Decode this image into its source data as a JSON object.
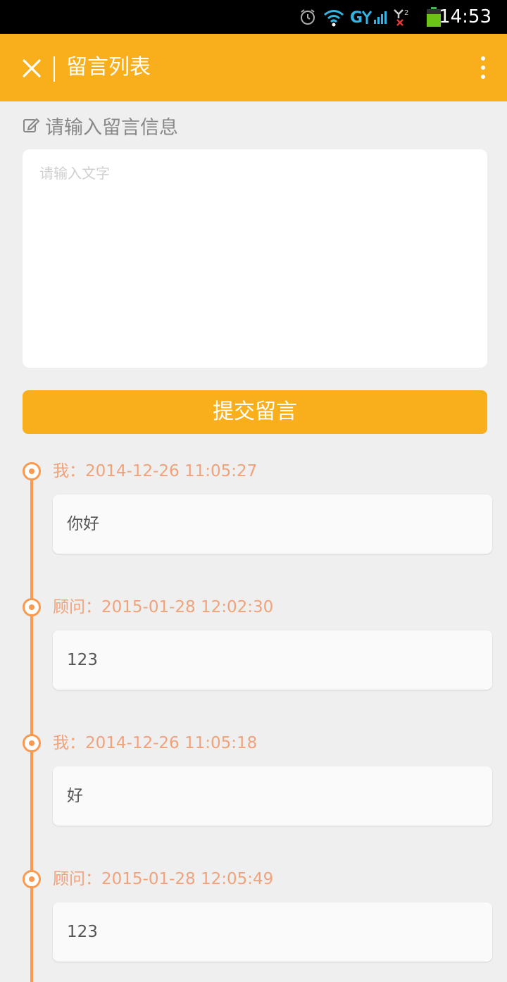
{
  "status_bar": {
    "time": "14:53",
    "icons": [
      "alarm-icon",
      "wifi-icon",
      "signal-icon",
      "sim2-signal-icon",
      "battery-icon"
    ]
  },
  "app_bar": {
    "title": "留言列表",
    "close_icon": "close-icon",
    "more_icon": "more-vertical-icon"
  },
  "compose": {
    "label": "请输入留言信息",
    "icon": "edit-icon",
    "placeholder": "请输入文字",
    "value": "",
    "submit_label": "提交留言"
  },
  "messages": [
    {
      "sender": "我",
      "separator": "：",
      "timestamp": "2014-12-26 11:05:27",
      "text": "你好"
    },
    {
      "sender": "顾问",
      "separator": "：",
      "timestamp": "2015-01-28 12:02:30",
      "text": "123"
    },
    {
      "sender": "我",
      "separator": "：",
      "timestamp": "2014-12-26 11:05:18",
      "text": "好"
    },
    {
      "sender": "顾问",
      "separator": "：",
      "timestamp": "2015-01-28 12:05:49",
      "text": "123"
    }
  ],
  "colors": {
    "accent": "#f9af1b",
    "timeline": "#fb9a4f",
    "meta_text": "#f0a27a",
    "background": "#efefef"
  }
}
